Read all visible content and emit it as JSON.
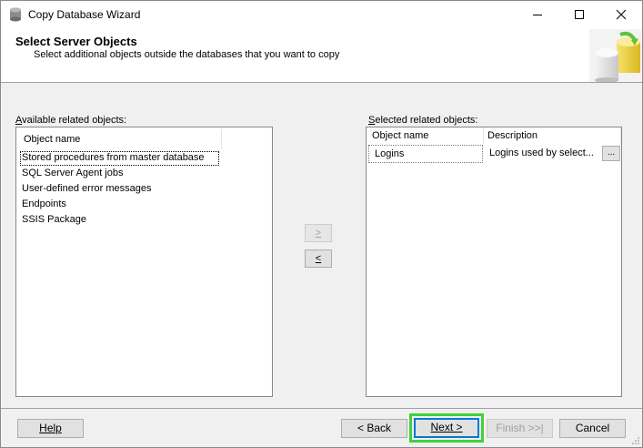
{
  "window": {
    "title": "Copy Database Wizard",
    "icons": {
      "app": "database-icon",
      "min": "minimize-icon",
      "max": "maximize-icon",
      "close": "close-icon"
    }
  },
  "header": {
    "title": "Select Server Objects",
    "subtitle": "Select additional objects outside the databases that you want to copy",
    "art_icon": "wizard-database-art-icon"
  },
  "available": {
    "label_prefix": "",
    "label_accel": "A",
    "label_rest": "vailable related objects:",
    "column": "Object name",
    "items": [
      "Stored procedures from master database",
      "SQL Server Agent jobs",
      "User-defined error messages",
      "Endpoints",
      "SSIS Package"
    ]
  },
  "selected": {
    "label_accel": "S",
    "label_rest": "elected related objects:",
    "columns": [
      "Object name",
      "Description"
    ],
    "rows": [
      {
        "name": "Logins",
        "description": "Logins used by select...",
        "button": "..."
      }
    ]
  },
  "arrows": {
    "add": ">",
    "remove": "<"
  },
  "footer": {
    "help": "Help",
    "back": "< Back",
    "next": "Next >",
    "finish": "Finish >>|",
    "cancel": "Cancel"
  },
  "colors": {
    "highlight": "#3fd23a",
    "focus": "#0078d7"
  }
}
